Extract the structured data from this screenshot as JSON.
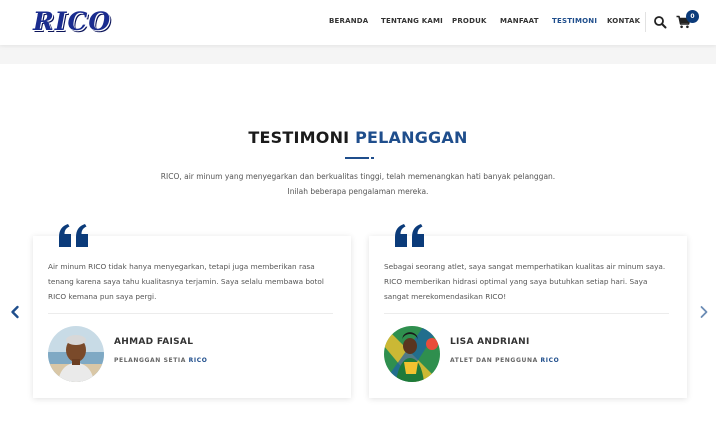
{
  "brand": {
    "logo_text": "RICO",
    "accent_color": "#1f4e8c",
    "dark_navy": "#0b3b7a"
  },
  "nav": {
    "items": [
      {
        "label": "BERANDA",
        "active": false
      },
      {
        "label": "TENTANG KAMI",
        "active": false
      },
      {
        "label": "PRODUK",
        "active": false
      },
      {
        "label": "MANFAAT",
        "active": false
      },
      {
        "label": "TESTIMONI",
        "active": true
      },
      {
        "label": "KONTAK",
        "active": false
      }
    ],
    "search_icon": "search-icon",
    "cart_icon": "shopping-cart-icon",
    "cart_count": "0"
  },
  "section": {
    "title_main": "TESTIMONI ",
    "title_accent": "PELANGGAN",
    "description_line1": "RICO, air minum yang menyegarkan dan berkualitas tinggi, telah memenangkan hati banyak pelanggan.",
    "description_line2": "Inilah beberapa pengalaman mereka."
  },
  "carousel": {
    "prev_icon": "chevron-left-icon",
    "next_icon": "chevron-right-icon"
  },
  "testimonials": [
    {
      "text": "Air minum RICO tidak hanya menyegarkan, tetapi juga memberikan rasa tenang karena saya tahu kualitasnya terjamin. Saya selalu membawa botol RICO kemana pun saya pergi.",
      "name": "AHMAD FAISAL",
      "role_prefix": "PELANGGAN SETIA ",
      "role_brand": "RICO"
    },
    {
      "text": "Sebagai seorang atlet, saya sangat memperhatikan kualitas air minum saya. RICO memberikan hidrasi optimal yang saya butuhkan setiap hari. Saya sangat merekomendasikan RICO!",
      "name": "LISA ANDRIANI",
      "role_prefix": "ATLET DAN PENGGUNA ",
      "role_brand": "RICO"
    }
  ]
}
